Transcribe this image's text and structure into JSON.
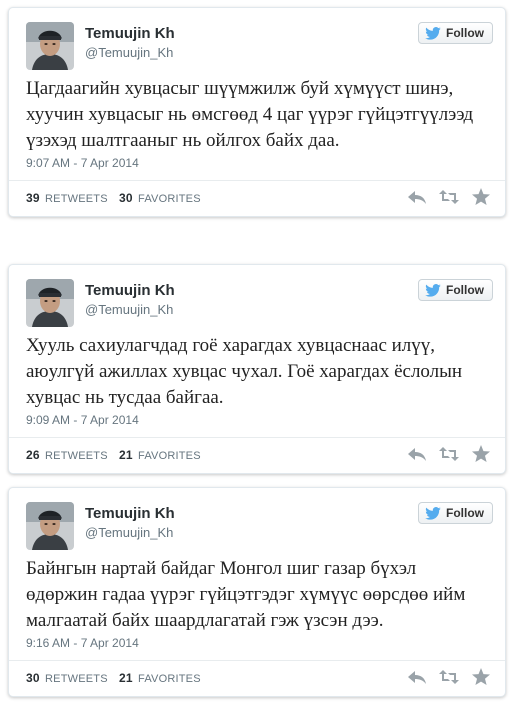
{
  "tweets": [
    {
      "name": "Temuujin Kh",
      "handle": "@Temuujin_Kh",
      "follow_label": "Follow",
      "text": "Цагдаагийн хувцасыг шүүмжилж буй хүмүүст шинэ,\nхуучин хувцасыг нь өмсгөөд 4 цаг үүрэг гүйцэтгүүлээд\nүзэхэд шалтгааныг нь ойлгох байх даа.",
      "time": "9:07 AM - 7 Apr 2014",
      "retweets": "39",
      "retweets_label": "RETWEETS",
      "favorites": "30",
      "favorites_label": "FAVORITES"
    },
    {
      "name": "Temuujin Kh",
      "handle": "@Temuujin_Kh",
      "follow_label": "Follow",
      "text": "Хууль сахиулагчдад гоё харагдах хувцаснаас илүү,\nаюулгүй ажиллах хувцас чухал. Гоё харагдах ёслолын\nхувцас нь тусдаа байгаа.",
      "time": "9:09 AM - 7 Apr 2014",
      "retweets": "26",
      "retweets_label": "RETWEETS",
      "favorites": "21",
      "favorites_label": "FAVORITES"
    },
    {
      "name": "Temuujin Kh",
      "handle": "@Temuujin_Kh",
      "follow_label": "Follow",
      "text": "Байнгын нартай байдаг Монгол шиг газар бүхэл\nөдөржин гадаа үүрэг гүйцэтгэдэг хүмүүс өөрсдөө ийм\nмалгаатай байх шаардлагатай гэж үзсэн  дээ.",
      "time": "9:16 AM - 7 Apr 2014",
      "retweets": "30",
      "retweets_label": "RETWEETS",
      "favorites": "21",
      "favorites_label": "FAVORITES"
    }
  ],
  "colors": {
    "twitter_blue": "#55acee",
    "muted_text": "#66757f",
    "icon_gray": "#9aa3a9"
  },
  "icons": {
    "follow": "twitter-bird-icon",
    "reply": "reply-icon",
    "retweet": "retweet-icon",
    "favorite": "star-icon"
  }
}
